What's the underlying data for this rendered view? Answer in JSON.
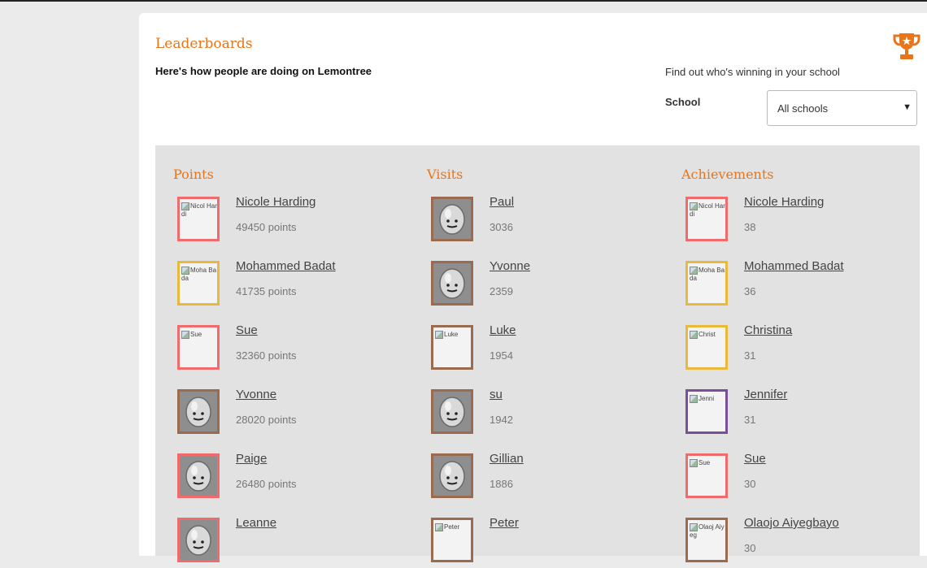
{
  "page": {
    "title": "Leaderboards",
    "subtitle": "Here's how people are doing on Lemontree",
    "trophy_icon": "trophy-icon"
  },
  "school_filter": {
    "hint": "Find out who's winning in your school",
    "label": "School",
    "selected": "All schools"
  },
  "colors": {
    "accent": "#e8751a",
    "border_red": "#f06b6b",
    "border_brown": "#9b6b4f",
    "border_yellow": "#e9b93c",
    "border_purple": "#7a4f9a"
  },
  "columns": [
    {
      "title": "Points",
      "entries": [
        {
          "name": "Nicole Harding",
          "score": "49450 points",
          "avatar_alt": "Nicol Hardi",
          "avatar": "broken",
          "border": "red"
        },
        {
          "name": "Mohammed Badat",
          "score": "41735 points",
          "avatar_alt": "Moha Bada",
          "avatar": "broken",
          "border": "yellow"
        },
        {
          "name": "Sue",
          "score": "32360 points",
          "avatar_alt": "Sue",
          "avatar": "broken",
          "border": "red"
        },
        {
          "name": "Yvonne",
          "score": "28020 points",
          "avatar_alt": "",
          "avatar": "lemon",
          "border": "brown"
        },
        {
          "name": "Paige",
          "score": "26480 points",
          "avatar_alt": "",
          "avatar": "lemon",
          "border": "red"
        },
        {
          "name": "Leanne",
          "score": "",
          "avatar_alt": "",
          "avatar": "lemon",
          "border": "red"
        }
      ]
    },
    {
      "title": "Visits",
      "entries": [
        {
          "name": "Paul",
          "score": "3036",
          "avatar_alt": "",
          "avatar": "lemon",
          "border": "brown"
        },
        {
          "name": "Yvonne",
          "score": "2359",
          "avatar_alt": "",
          "avatar": "lemon",
          "border": "brown"
        },
        {
          "name": "Luke",
          "score": "1954",
          "avatar_alt": "Luke",
          "avatar": "broken",
          "border": "brown"
        },
        {
          "name": "su",
          "score": "1942",
          "avatar_alt": "",
          "avatar": "lemon",
          "border": "brown"
        },
        {
          "name": "Gillian",
          "score": "1886",
          "avatar_alt": "",
          "avatar": "lemon",
          "border": "brown"
        },
        {
          "name": "Peter",
          "score": "",
          "avatar_alt": "Peter",
          "avatar": "broken",
          "border": "brown"
        }
      ]
    },
    {
      "title": "Achievements",
      "entries": [
        {
          "name": "Nicole Harding",
          "score": "38",
          "avatar_alt": "Nicol Hardi",
          "avatar": "broken",
          "border": "red"
        },
        {
          "name": "Mohammed Badat",
          "score": "36",
          "avatar_alt": "Moha Bada",
          "avatar": "broken",
          "border": "yellow"
        },
        {
          "name": "Christina",
          "score": "31",
          "avatar_alt": "Christ",
          "avatar": "broken",
          "border": "yellow"
        },
        {
          "name": "Jennifer",
          "score": "31",
          "avatar_alt": "Jenni",
          "avatar": "broken",
          "border": "purple"
        },
        {
          "name": "Sue",
          "score": "30",
          "avatar_alt": "Sue",
          "avatar": "broken",
          "border": "red"
        },
        {
          "name": "Olaojo Aiyegbayo",
          "score": "30",
          "avatar_alt": "Olaoj Aiyeg",
          "avatar": "broken",
          "border": "brown"
        }
      ]
    }
  ]
}
